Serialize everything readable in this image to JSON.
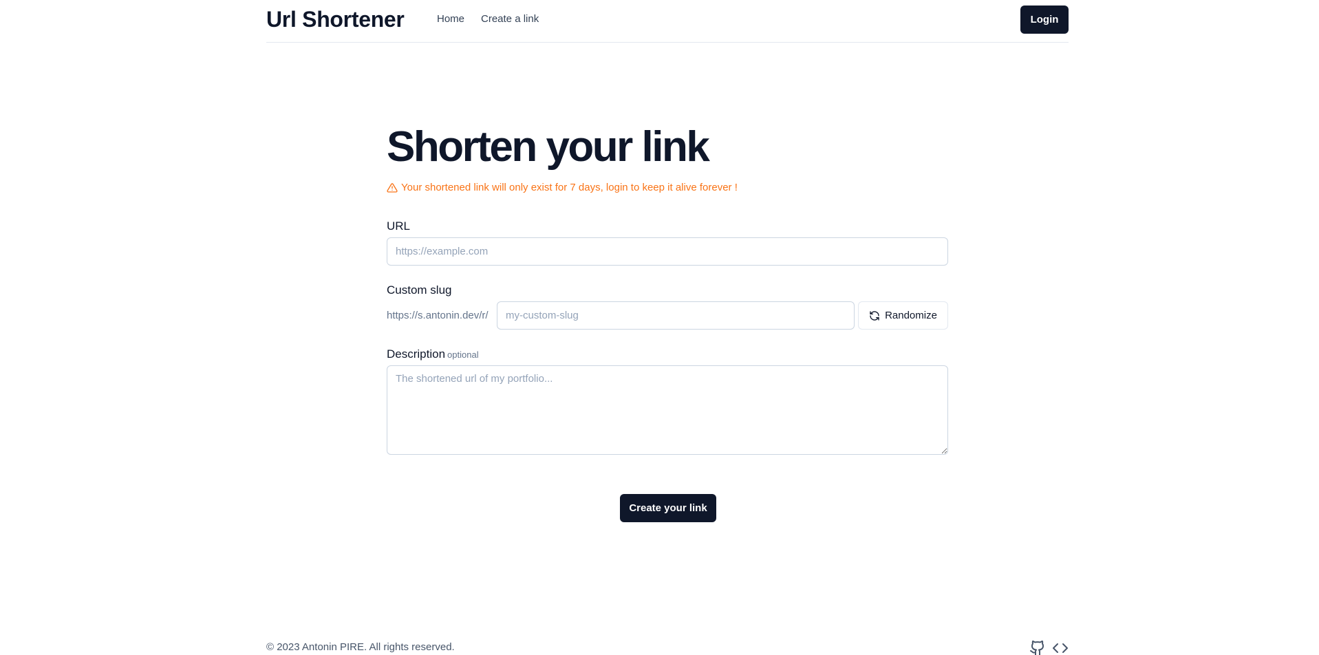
{
  "header": {
    "brand": "Url Shortener",
    "nav": {
      "home": "Home",
      "create": "Create a link"
    },
    "login_label": "Login"
  },
  "main": {
    "title": "Shorten your link",
    "warning": "Your shortened link will only exist for 7 days, login to keep it alive forever !",
    "url_label": "URL",
    "url_placeholder": "https://example.com",
    "slug_label": "Custom slug",
    "slug_prefix": "https://s.antonin.dev/r/",
    "slug_placeholder": "my-custom-slug",
    "randomize_label": "Randomize",
    "desc_label": "Description",
    "desc_optional": "optional",
    "desc_placeholder": "The shortened url of my portfolio...",
    "create_label": "Create your link"
  },
  "footer": {
    "copyright": "© 2023 Antonin PIRE. All rights reserved.",
    "icons": [
      "github-icon",
      "code-icon"
    ]
  },
  "colors": {
    "primary": "#0f172a",
    "warning": "#f97316",
    "border": "#cbd5e1",
    "muted": "#64748b"
  }
}
